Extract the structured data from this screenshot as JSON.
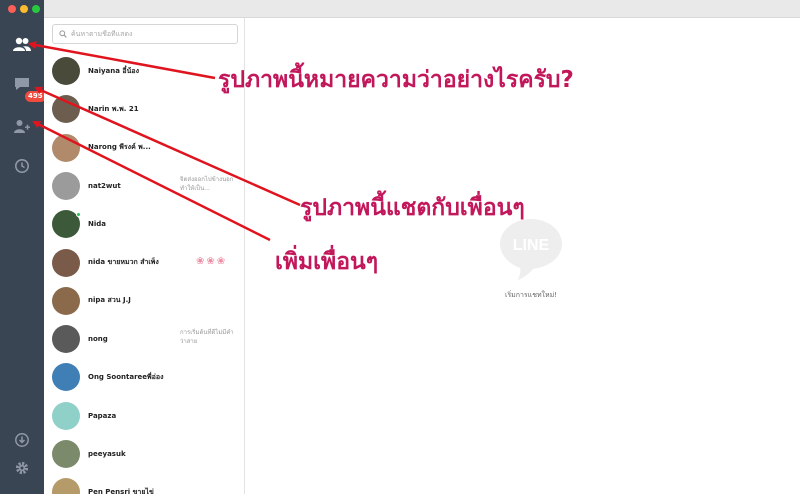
{
  "window": {
    "controls": [
      "close",
      "minimize",
      "zoom"
    ]
  },
  "sidebar": {
    "items": [
      {
        "name": "friends",
        "icon": "friends-icon"
      },
      {
        "name": "chats",
        "icon": "chat-icon",
        "badge": "495"
      },
      {
        "name": "add-friend",
        "icon": "add-friend-icon"
      },
      {
        "name": "timeline",
        "icon": "clock-icon"
      }
    ],
    "bottom": [
      {
        "name": "download",
        "icon": "download-icon"
      },
      {
        "name": "settings",
        "icon": "gear-icon"
      }
    ]
  },
  "search": {
    "placeholder": "ค้นหาตามชื่อที่แสดง"
  },
  "friends": [
    {
      "name": "Naiyana อี๋น้อง",
      "status": ""
    },
    {
      "name": "Narin พ.พ. 21",
      "status": ""
    },
    {
      "name": "Narong พีรงค์ พ...",
      "status": ""
    },
    {
      "name": "nat2wut",
      "status": "จิตส่งออกไปข้างนอกทำให้เป็น..."
    },
    {
      "name": "Nida",
      "status": "",
      "online": true
    },
    {
      "name": "nida ขายหมวก สำเพ็ง",
      "status": "",
      "flowers": "❀❀❀"
    },
    {
      "name": "nipa สวน J.J",
      "status": ""
    },
    {
      "name": "nong",
      "status": "การเริ่มต้นที่ดีไม่มีคำว่าสาย"
    },
    {
      "name": "Ong Soontareeพี่อ่อง",
      "status": ""
    },
    {
      "name": "Papaza",
      "status": ""
    },
    {
      "name": "peeyasuk",
      "status": ""
    },
    {
      "name": "Pen Pensri ขายไข่",
      "status": ""
    }
  ],
  "chat": {
    "logo_text": "LINE",
    "empty_text": "เริ่มการแชทใหม่!"
  },
  "annotations": {
    "a1": "รูปภาพนี้หมายความว่าอย่างไรครับ?",
    "a2": "รูปภาพนี้แชตกับเพื่อนๆ",
    "a3": "เพิ่มเพื่อนๆ",
    "color": "#c2185b",
    "arrow_color": "#e0141e"
  },
  "colors": {
    "sidebar": "#3a4553",
    "badge": "#ef4b3f",
    "online": "#2bc05a"
  }
}
